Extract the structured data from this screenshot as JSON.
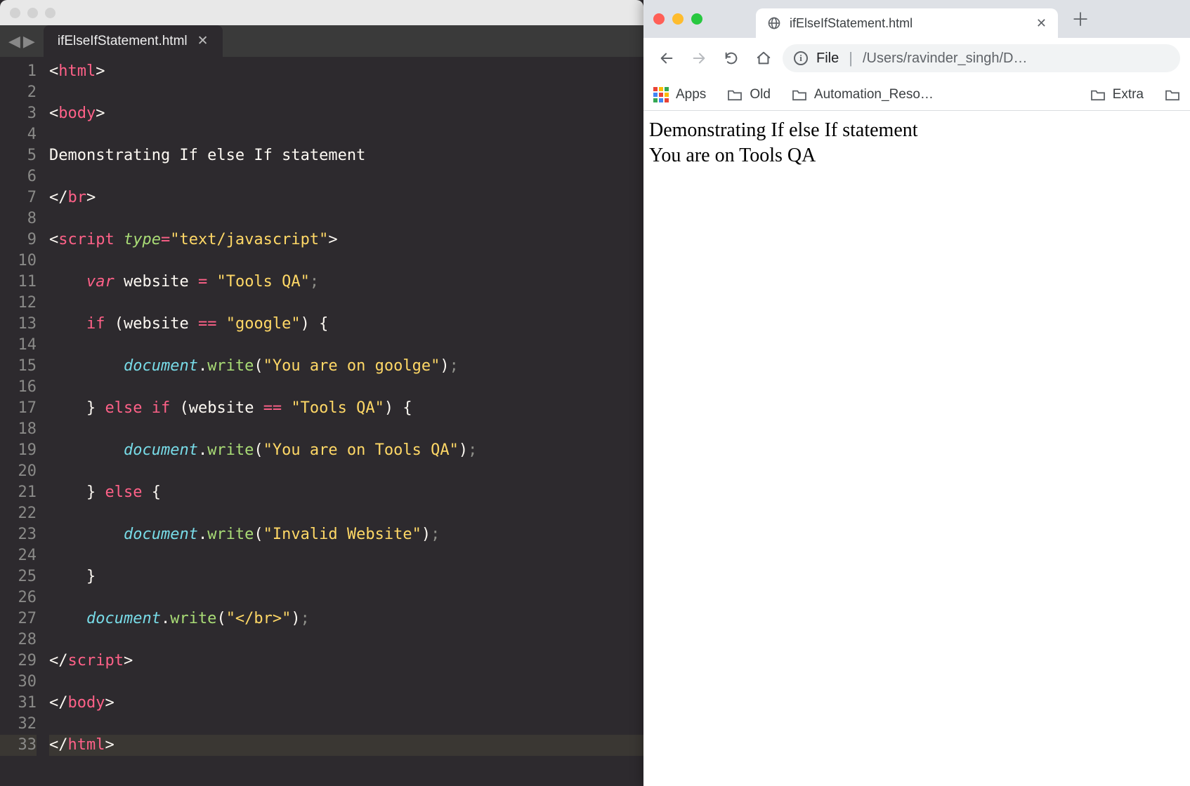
{
  "editor": {
    "tab_title": "ifElseIfStatement.html",
    "line_count": 33,
    "code_lines": [
      {
        "n": 1,
        "html": "<span class='ang'>&lt;</span><span class='tag'>html</span><span class='ang'>&gt;</span>"
      },
      {
        "n": 2,
        "html": ""
      },
      {
        "n": 3,
        "html": "<span class='ang'>&lt;</span><span class='tag'>body</span><span class='ang'>&gt;</span>"
      },
      {
        "n": 4,
        "html": ""
      },
      {
        "n": 5,
        "html": "<span class='id'>Demonstrating If else If statement</span>"
      },
      {
        "n": 6,
        "html": ""
      },
      {
        "n": 7,
        "html": "<span class='ang'>&lt;/</span><span class='tag'>br</span><span class='ang'>&gt;</span>"
      },
      {
        "n": 8,
        "html": ""
      },
      {
        "n": 9,
        "html": "<span class='ang'>&lt;</span><span class='tag'>script</span> <span class='attr' style='font-style:italic'>type</span><span class='op'>=</span><span class='str'>\"text/javascript\"</span><span class='ang'>&gt;</span>"
      },
      {
        "n": 10,
        "html": "    "
      },
      {
        "n": 11,
        "html": "    <span class='tag' style='font-style:italic'>var</span> <span class='id'>website</span> <span class='op'>=</span> <span class='str'>\"Tools QA\"</span><span class='semi'>;</span>"
      },
      {
        "n": 12,
        "html": "    "
      },
      {
        "n": 13,
        "html": "    <span class='tag'>if</span> <span class='ang'>(</span><span class='id'>website</span> <span class='op'>==</span> <span class='str'>\"google\"</span><span class='ang'>) {</span>"
      },
      {
        "n": 14,
        "html": "    "
      },
      {
        "n": 15,
        "html": "        <span class='ital'>document</span><span class='ang'>.</span><span class='fn'>write</span><span class='ang'>(</span><span class='str'>\"You are on goolge\"</span><span class='ang'>)</span><span class='semi'>;</span>"
      },
      {
        "n": 16,
        "html": "    "
      },
      {
        "n": 17,
        "html": "    <span class='ang'>}</span> <span class='tag'>else</span> <span class='tag'>if</span> <span class='ang'>(</span><span class='id'>website</span> <span class='op'>==</span> <span class='str'>\"Tools QA\"</span><span class='ang'>) {</span>"
      },
      {
        "n": 18,
        "html": "    "
      },
      {
        "n": 19,
        "html": "        <span class='ital'>document</span><span class='ang'>.</span><span class='fn'>write</span><span class='ang'>(</span><span class='str'>\"You are on Tools QA\"</span><span class='ang'>)</span><span class='semi'>;</span>"
      },
      {
        "n": 20,
        "html": "    "
      },
      {
        "n": 21,
        "html": "    <span class='ang'>}</span> <span class='tag'>else</span> <span class='ang'>{</span>"
      },
      {
        "n": 22,
        "html": "    "
      },
      {
        "n": 23,
        "html": "        <span class='ital'>document</span><span class='ang'>.</span><span class='fn'>write</span><span class='ang'>(</span><span class='str'>\"Invalid Website\"</span><span class='ang'>)</span><span class='semi'>;</span>"
      },
      {
        "n": 24,
        "html": "    "
      },
      {
        "n": 25,
        "html": "    <span class='ang'>}</span>"
      },
      {
        "n": 26,
        "html": "    "
      },
      {
        "n": 27,
        "html": "    <span class='ital'>document</span><span class='ang'>.</span><span class='fn'>write</span><span class='ang'>(</span><span class='str'>\"&lt;/br&gt;\"</span><span class='ang'>)</span><span class='semi'>;</span>"
      },
      {
        "n": 28,
        "html": "    "
      },
      {
        "n": 29,
        "html": "<span class='ang'>&lt;/</span><span class='tag'>script</span><span class='ang'>&gt;</span>"
      },
      {
        "n": 30,
        "html": ""
      },
      {
        "n": 31,
        "html": "<span class='ang'>&lt;/</span><span class='tag'>body</span><span class='ang'>&gt;</span>"
      },
      {
        "n": 32,
        "html": ""
      },
      {
        "n": 33,
        "html": "<span class='ang'>&lt;/</span><span class='tag'>html</span><span class='ang'>&gt;</span>"
      }
    ]
  },
  "browser": {
    "tab_title": "ifElseIfStatement.html",
    "address_scheme": "File",
    "address_path": "/Users/ravinder_singh/D…",
    "bookmarks": {
      "apps": "Apps",
      "items": [
        "Old",
        "Automation_Reso…",
        "Extra"
      ]
    },
    "page": {
      "line1": "Demonstrating If else If statement",
      "line2": "You are on Tools QA"
    }
  }
}
